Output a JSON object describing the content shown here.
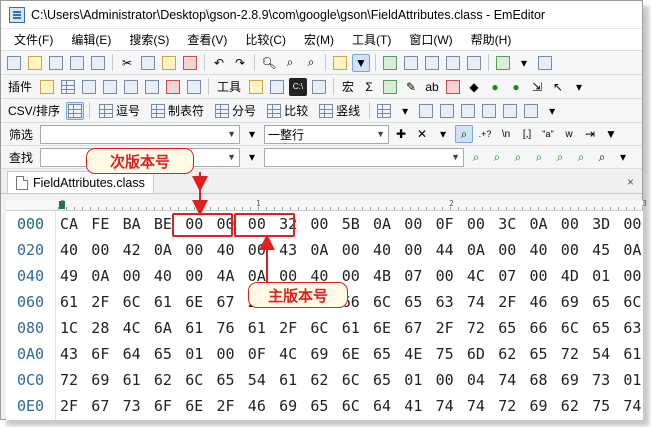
{
  "window": {
    "title": "C:\\Users\\Administrator\\Desktop\\gson-2.8.9\\com\\google\\gson\\FieldAttributes.class - EmEditor"
  },
  "menu": [
    "文件(F)",
    "编辑(E)",
    "搜索(S)",
    "查看(V)",
    "比较(C)",
    "宏(M)",
    "工具(T)",
    "窗口(W)",
    "帮助(H)"
  ],
  "toolbar2": {
    "plugins_label": "插件",
    "tools_label": "工具",
    "macro_label": "宏",
    "sigma": "Σ"
  },
  "toolbar3": {
    "csv_label": "CSV/排序",
    "comma_label": "逗号",
    "tab_label": "制表符",
    "semicolon_label": "分号",
    "compare_label": "比较",
    "pipe_label": "竖线"
  },
  "filter": {
    "label": "筛选",
    "value": "",
    "mode": "一整行",
    "regex_icon": ".+?",
    "newline_icon": "\\n",
    "bracket_icon": "[,]",
    "quote_icon": "\"a\""
  },
  "find": {
    "label": "查找",
    "value": ""
  },
  "tab": {
    "name": "FieldAttributes.class",
    "close": "×"
  },
  "ruler": {
    "marks": [
      "0",
      "1",
      "2",
      "3"
    ]
  },
  "hex": {
    "rows": [
      {
        "addr": "000",
        "bytes": [
          "CA",
          "FE",
          "BA",
          "BE",
          "00",
          "00",
          "00",
          "32",
          "00",
          "5B",
          "0A",
          "00",
          "0F",
          "00",
          "3C",
          "0A",
          "00",
          "3D",
          "00"
        ]
      },
      {
        "addr": "020",
        "bytes": [
          "40",
          "00",
          "42",
          "0A",
          "00",
          "40",
          "00",
          "43",
          "0A",
          "00",
          "40",
          "00",
          "44",
          "0A",
          "00",
          "40",
          "00",
          "45",
          "0A"
        ]
      },
      {
        "addr": "040",
        "bytes": [
          "49",
          "0A",
          "00",
          "40",
          "00",
          "4A",
          "0A",
          "00",
          "40",
          "00",
          "4B",
          "07",
          "00",
          "4C",
          "07",
          "00",
          "4D",
          "01",
          "00"
        ]
      },
      {
        "addr": "060",
        "bytes": [
          "61",
          "2F",
          "6C",
          "61",
          "6E",
          "67",
          "2F",
          "72",
          "65",
          "66",
          "6C",
          "65",
          "63",
          "74",
          "2F",
          "46",
          "69",
          "65",
          "6C"
        ]
      },
      {
        "addr": "080",
        "bytes": [
          "1C",
          "28",
          "4C",
          "6A",
          "61",
          "76",
          "61",
          "2F",
          "6C",
          "61",
          "6E",
          "67",
          "2F",
          "72",
          "65",
          "66",
          "6C",
          "65",
          "63"
        ]
      },
      {
        "addr": "0A0",
        "bytes": [
          "43",
          "6F",
          "64",
          "65",
          "01",
          "00",
          "0F",
          "4C",
          "69",
          "6E",
          "65",
          "4E",
          "75",
          "6D",
          "62",
          "65",
          "72",
          "54",
          "61"
        ]
      },
      {
        "addr": "0C0",
        "bytes": [
          "72",
          "69",
          "61",
          "62",
          "6C",
          "65",
          "54",
          "61",
          "62",
          "6C",
          "65",
          "01",
          "00",
          "04",
          "74",
          "68",
          "69",
          "73",
          "01"
        ]
      },
      {
        "addr": "0E0",
        "bytes": [
          "2F",
          "67",
          "73",
          "6F",
          "6E",
          "2F",
          "46",
          "69",
          "65",
          "6C",
          "64",
          "41",
          "74",
          "74",
          "72",
          "69",
          "62",
          "75",
          "74"
        ]
      }
    ]
  },
  "annotations": {
    "minor_label": "次版本号",
    "major_label": "主版本号",
    "color": "#e02020"
  }
}
